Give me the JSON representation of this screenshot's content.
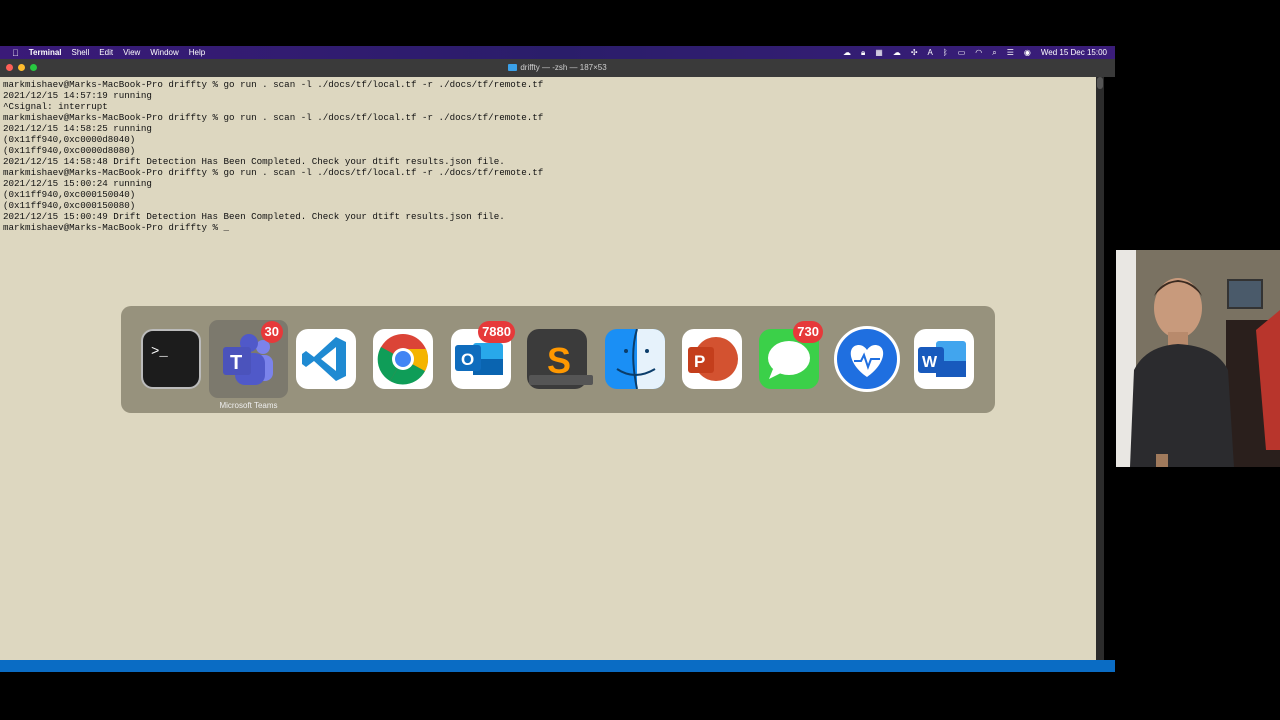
{
  "menubar": {
    "apple_icon": "apple-icon",
    "items": [
      "Terminal",
      "Shell",
      "Edit",
      "View",
      "Window",
      "Help"
    ],
    "clock": "Wed 15 Dec  15:00"
  },
  "window": {
    "title": "driffty — -zsh — 187×53"
  },
  "terminal": {
    "lines": [
      "markmishaev@Marks-MacBook-Pro driffty % go run . scan -l ./docs/tf/local.tf -r ./docs/tf/remote.tf",
      "2021/12/15 14:57:19 running",
      "^Csignal: interrupt",
      "markmishaev@Marks-MacBook-Pro driffty % go run . scan -l ./docs/tf/local.tf -r ./docs/tf/remote.tf",
      "2021/12/15 14:58:25 running",
      "(0x11ff940,0xc0000d8040)",
      "(0x11ff940,0xc0000d8080)",
      "2021/12/15 14:58:48 Drift Detection Has Been Completed. Check your dtift results.json file.",
      "markmishaev@Marks-MacBook-Pro driffty % go run . scan -l ./docs/tf/local.tf -r ./docs/tf/remote.tf",
      "2021/12/15 15:00:24 running",
      "(0x11ff940,0xc000150040)",
      "(0x11ff940,0xc000150080)",
      "2021/12/15 15:00:49 Drift Detection Has Been Completed. Check your dtift results.json file.",
      "markmishaev@Marks-MacBook-Pro driffty % _"
    ]
  },
  "app_switcher": {
    "selected_label": "Microsoft Teams",
    "apps": [
      {
        "name": "Terminal",
        "icon": "terminal-icon",
        "badge": ""
      },
      {
        "name": "Microsoft Teams",
        "icon": "teams-icon",
        "badge": "30"
      },
      {
        "name": "Visual Studio Code",
        "icon": "vscode-icon",
        "badge": ""
      },
      {
        "name": "Google Chrome",
        "icon": "chrome-icon",
        "badge": ""
      },
      {
        "name": "Microsoft Outlook",
        "icon": "outlook-icon",
        "badge": "7880"
      },
      {
        "name": "Sublime Text",
        "icon": "sublime-icon",
        "badge": ""
      },
      {
        "name": "Finder",
        "icon": "finder-icon",
        "badge": ""
      },
      {
        "name": "Microsoft PowerPoint",
        "icon": "powerpoint-icon",
        "badge": ""
      },
      {
        "name": "Messages",
        "icon": "messages-icon",
        "badge": "730"
      },
      {
        "name": "Health Monitor",
        "icon": "heart-monitor-icon",
        "badge": ""
      },
      {
        "name": "Microsoft Word",
        "icon": "word-icon",
        "badge": ""
      }
    ]
  },
  "colors": {
    "terminal_bg": "#ddd7c0",
    "menubar_bg": "#2a1d6a",
    "badge": "#e6393a"
  }
}
